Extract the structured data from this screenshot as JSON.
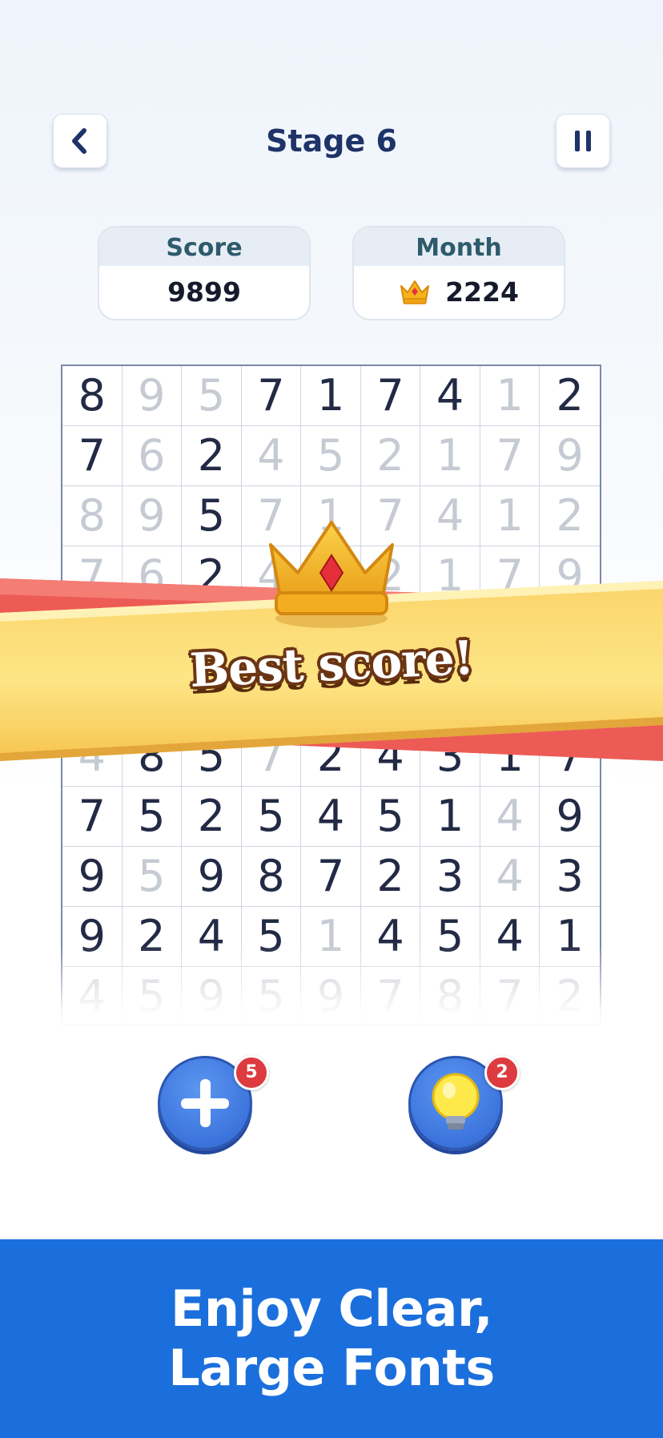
{
  "header": {
    "title": "Stage 6",
    "back_icon": "chevron-left-icon",
    "pause_icon": "pause-icon"
  },
  "stats": {
    "score_label": "Score",
    "score_value": "9899",
    "month_label": "Month",
    "month_value": "2224",
    "month_icon": "crown-icon"
  },
  "grid": {
    "rows": [
      [
        [
          "8",
          0
        ],
        [
          "9",
          1
        ],
        [
          "5",
          1
        ],
        [
          "7",
          0
        ],
        [
          "1",
          0
        ],
        [
          "7",
          0
        ],
        [
          "4",
          0
        ],
        [
          "1",
          1
        ],
        [
          "2",
          0
        ]
      ],
      [
        [
          "7",
          0
        ],
        [
          "6",
          1
        ],
        [
          "2",
          0
        ],
        [
          "4",
          1
        ],
        [
          "5",
          1
        ],
        [
          "2",
          1
        ],
        [
          "1",
          1
        ],
        [
          "7",
          1
        ],
        [
          "9",
          1
        ]
      ],
      [
        [
          "8",
          1
        ],
        [
          "9",
          1
        ],
        [
          "5",
          0
        ],
        [
          "7",
          1
        ],
        [
          "1",
          1
        ],
        [
          "7",
          1
        ],
        [
          "4",
          1
        ],
        [
          "1",
          1
        ],
        [
          "2",
          1
        ]
      ],
      [
        [
          "7",
          1
        ],
        [
          "6",
          1
        ],
        [
          "2",
          0
        ],
        [
          "4",
          1
        ],
        [
          "5",
          1
        ],
        [
          "2",
          1
        ],
        [
          "1",
          1
        ],
        [
          "7",
          1
        ],
        [
          "9",
          1
        ]
      ],
      [
        [
          "",
          0
        ],
        [
          "",
          0
        ],
        [
          "",
          0
        ],
        [
          "",
          0
        ],
        [
          "",
          0
        ],
        [
          "",
          0
        ],
        [
          "",
          0
        ],
        [
          "",
          0
        ],
        [
          "",
          0
        ]
      ],
      [
        [
          "",
          0
        ],
        [
          "",
          0
        ],
        [
          "",
          0
        ],
        [
          "",
          0
        ],
        [
          "",
          0
        ],
        [
          "",
          0
        ],
        [
          "",
          0
        ],
        [
          "",
          0
        ],
        [
          "",
          0
        ]
      ],
      [
        [
          "4",
          1
        ],
        [
          "8",
          0
        ],
        [
          "5",
          0
        ],
        [
          "7",
          1
        ],
        [
          "2",
          0
        ],
        [
          "4",
          0
        ],
        [
          "3",
          0
        ],
        [
          "1",
          0
        ],
        [
          "7",
          0
        ]
      ],
      [
        [
          "7",
          0
        ],
        [
          "5",
          0
        ],
        [
          "2",
          0
        ],
        [
          "5",
          0
        ],
        [
          "4",
          0
        ],
        [
          "5",
          0
        ],
        [
          "1",
          0
        ],
        [
          "4",
          1
        ],
        [
          "9",
          0
        ]
      ],
      [
        [
          "9",
          0
        ],
        [
          "5",
          1
        ],
        [
          "9",
          0
        ],
        [
          "8",
          0
        ],
        [
          "7",
          0
        ],
        [
          "2",
          0
        ],
        [
          "3",
          0
        ],
        [
          "4",
          1
        ],
        [
          "3",
          0
        ]
      ],
      [
        [
          "9",
          0
        ],
        [
          "2",
          0
        ],
        [
          "4",
          0
        ],
        [
          "5",
          0
        ],
        [
          "1",
          1
        ],
        [
          "4",
          0
        ],
        [
          "5",
          0
        ],
        [
          "4",
          0
        ],
        [
          "1",
          0
        ]
      ],
      [
        [
          "4",
          1
        ],
        [
          "5",
          1
        ],
        [
          "9",
          1
        ],
        [
          "5",
          1
        ],
        [
          "9",
          1
        ],
        [
          "7",
          1
        ],
        [
          "8",
          1
        ],
        [
          "7",
          1
        ],
        [
          "2",
          1
        ]
      ]
    ]
  },
  "banner": {
    "text": "Best score!",
    "icon": "crown-icon"
  },
  "tools": {
    "add_badge": "5",
    "add_icon": "plus-icon",
    "hint_badge": "2",
    "hint_icon": "lightbulb-icon"
  },
  "footer": {
    "line1": "Enjoy Clear,",
    "line2": "Large Fonts"
  }
}
